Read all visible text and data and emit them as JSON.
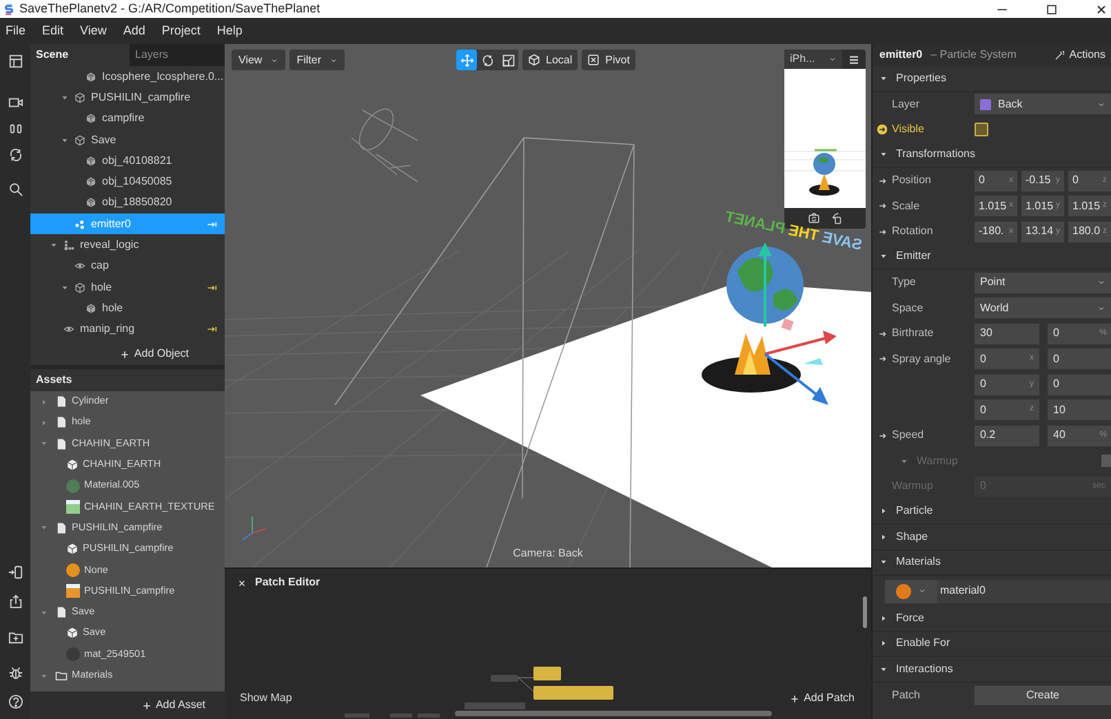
{
  "window": {
    "title": "SaveThePlanetv2 - G:/AR/Competition/SaveThePlanet"
  },
  "menu": [
    "File",
    "Edit",
    "View",
    "Add",
    "Project",
    "Help"
  ],
  "scene_panel": {
    "tabs": [
      {
        "label": "Scene",
        "selected": true
      },
      {
        "label": "Layers",
        "selected": false
      }
    ],
    "tree": [
      {
        "children": [
          {
            "children": [
              {
                "label": "Icosphere_Icosphere.0...",
                "kind": "mesh",
                "selected": false,
                "linked": false
              }
            ]
          },
          {
            "label": "PUSHILIN_campfire",
            "kind": "object",
            "expanded": true,
            "selected": false,
            "linked": false,
            "children": [
              {
                "label": "campfire",
                "kind": "mesh",
                "selected": false,
                "linked": false
              }
            ]
          },
          {
            "label": "Save",
            "kind": "object",
            "expanded": true,
            "selected": false,
            "linked": false,
            "children": [
              {
                "label": "obj_40108821",
                "kind": "mesh",
                "selected": false,
                "linked": false
              },
              {
                "label": "obj_10450085",
                "kind": "mesh",
                "selected": false,
                "linked": false
              },
              {
                "label": "obj_18850820",
                "kind": "mesh",
                "selected": false,
                "linked": false
              }
            ]
          },
          {
            "label": "emitter0",
            "kind": "emitter",
            "selected": true,
            "linked": true
          }
        ]
      },
      {
        "label": "reveal_logic",
        "kind": "logic",
        "expanded": true,
        "selected": false,
        "linked": false,
        "children": [
          {
            "label": "cap",
            "kind": "plane",
            "selected": false,
            "linked": false
          },
          {
            "label": "hole",
            "kind": "object",
            "expanded": true,
            "selected": false,
            "linked": true,
            "children": [
              {
                "label": "hole",
                "kind": "mesh",
                "selected": false,
                "linked": false
              }
            ]
          }
        ]
      },
      {
        "label": "manip_ring",
        "kind": "plane",
        "selected": false,
        "linked": true
      }
    ],
    "add_button": "Add Object"
  },
  "assets_panel": {
    "title": "Assets",
    "tree": [
      {
        "label": "Cylinder",
        "kind": "file",
        "expanded": false
      },
      {
        "label": "hole",
        "kind": "file",
        "expanded": false
      },
      {
        "label": "CHAHIN_EARTH",
        "kind": "file",
        "expanded": true,
        "children": [
          {
            "label": "CHAHIN_EARTH",
            "kind": "mesh"
          },
          {
            "label": "Material.005",
            "kind": "material",
            "color": "#4e7d57"
          },
          {
            "label": "CHAHIN_EARTH_TEXTURE",
            "kind": "texture",
            "color": "#8fcf8a"
          }
        ]
      },
      {
        "label": "PUSHILIN_campfire",
        "kind": "file",
        "expanded": true,
        "children": [
          {
            "label": "PUSHILIN_campfire",
            "kind": "mesh"
          },
          {
            "label": "None",
            "kind": "material",
            "color": "#e3901c"
          },
          {
            "label": "PUSHILIN_campfire",
            "kind": "texture",
            "color": "#e8962a"
          }
        ]
      },
      {
        "label": "Save",
        "kind": "file",
        "expanded": true,
        "children": [
          {
            "label": "Save",
            "kind": "mesh"
          },
          {
            "label": "mat_2549501",
            "kind": "material",
            "color": "#3a3a3a"
          }
        ]
      },
      {
        "label": "Materials",
        "kind": "folder",
        "expanded": true
      }
    ],
    "add_button": "Add Asset"
  },
  "viewport": {
    "view_menu": "View",
    "filter_menu": "Filter",
    "tools": [
      {
        "kind": "move",
        "selected": true
      },
      {
        "kind": "rotate",
        "selected": false
      },
      {
        "kind": "scale",
        "selected": false
      }
    ],
    "space_button": "Local",
    "pivot_button": "Pivot",
    "device_menu": "iPh...",
    "camera_label": "Camera: Back",
    "scene_text": [
      {
        "text": "SAVE",
        "color": "#8cc4ee"
      },
      {
        "text": "THE",
        "color": "#f3d320"
      },
      {
        "text": "PLANET",
        "color": "#5cb24c"
      }
    ]
  },
  "patch_editor": {
    "title": "Patch Editor",
    "show_map": "Show Map",
    "add_button": "Add Patch"
  },
  "inspector": {
    "name": "emitter0",
    "type": "– Particle System",
    "actions": "Actions",
    "sections": [
      {
        "title": "Properties",
        "expanded": true,
        "rows": [
          {
            "kind": "dropdown",
            "label": "Layer",
            "value": "Back",
            "color": "#8b6fd8",
            "connectable": false
          },
          {
            "kind": "checkbox",
            "label": "Visible",
            "checked": false,
            "connectable": true,
            "linked": true
          }
        ]
      },
      {
        "title": "Transformations",
        "expanded": true,
        "rows": [
          {
            "kind": "vector",
            "label": "Position",
            "connectable": true,
            "linked": false,
            "fields": [
              {
                "value": "0",
                "axis": "x"
              },
              {
                "value": "-0.15",
                "axis": "y"
              },
              {
                "value": "0",
                "axis": "z"
              }
            ]
          },
          {
            "kind": "vector",
            "label": "Scale",
            "connectable": true,
            "linked": false,
            "fields": [
              {
                "value": "1.015",
                "axis": "x"
              },
              {
                "value": "1.015",
                "axis": "y"
              },
              {
                "value": "1.015",
                "axis": "z"
              }
            ]
          },
          {
            "kind": "vector",
            "label": "Rotation",
            "connectable": true,
            "linked": false,
            "fields": [
              {
                "value": "-180.",
                "axis": "x"
              },
              {
                "value": "13.14",
                "axis": "y"
              },
              {
                "value": "180.0",
                "axis": "z"
              }
            ]
          }
        ]
      },
      {
        "title": "Emitter",
        "expanded": true,
        "rows": [
          {
            "kind": "dropdown",
            "label": "Type",
            "value": "Point",
            "connectable": false
          },
          {
            "kind": "dropdown",
            "label": "Space",
            "value": "World",
            "connectable": false
          },
          {
            "kind": "pair",
            "label": "Birthrate",
            "connectable": true,
            "linked": false,
            "fields": [
              {
                "value": "30"
              },
              {
                "value": "0",
                "unit": "%"
              }
            ]
          },
          {
            "kind": "pair",
            "label": "Spray angle",
            "connectable": true,
            "linked": false,
            "fields": [
              {
                "value": "0",
                "unit": "x"
              },
              {
                "value": "0"
              }
            ]
          },
          {
            "kind": "pair",
            "connectable": false,
            "fields": [
              {
                "value": "0",
                "unit": "y"
              },
              {
                "value": "0"
              }
            ]
          },
          {
            "kind": "pair",
            "connectable": false,
            "fields": [
              {
                "value": "0",
                "unit": "z"
              },
              {
                "value": "10"
              }
            ]
          },
          {
            "kind": "pair",
            "label": "Speed",
            "connectable": true,
            "linked": false,
            "fields": [
              {
                "value": "0.2"
              },
              {
                "value": "40",
                "unit": "%"
              }
            ]
          },
          {
            "kind": "subsection",
            "label": "Warmup",
            "expanded": true,
            "checked": false,
            "disabled": true
          },
          {
            "kind": "field",
            "label": "Warmup",
            "value": "0",
            "unit": "sec",
            "disabled": true
          }
        ]
      },
      {
        "title": "Particle",
        "expanded": false
      },
      {
        "title": "Shape",
        "expanded": false
      },
      {
        "title": "Materials",
        "expanded": true,
        "rows": [
          {
            "kind": "material",
            "value": "material0",
            "color": "#e07a18"
          }
        ]
      },
      {
        "title": "Force",
        "expanded": false
      },
      {
        "title": "Enable For",
        "expanded": false
      },
      {
        "title": "Interactions",
        "expanded": true,
        "rows": [
          {
            "kind": "button",
            "label": "Patch",
            "button": "Create",
            "connectable": false
          }
        ]
      }
    ]
  }
}
